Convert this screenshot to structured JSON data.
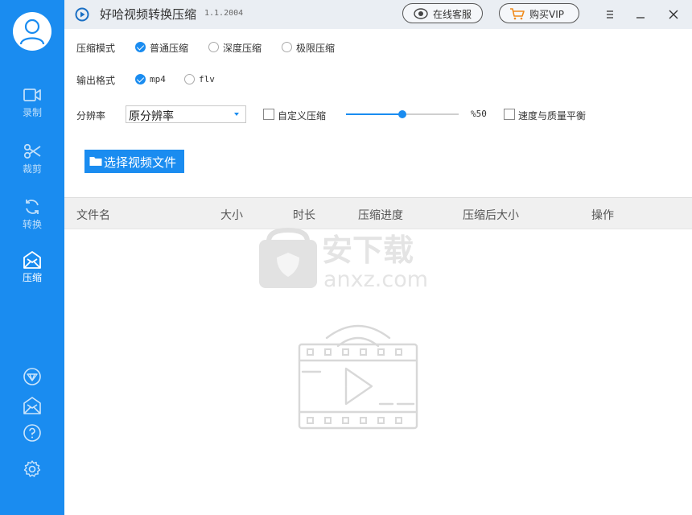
{
  "title_bar": {
    "app_title": "好哈视频转换压缩",
    "version": "1.1.2004",
    "support_button": "在线客服",
    "vip_button": "购买VIP"
  },
  "sidebar": {
    "items": [
      {
        "label": "录制",
        "icon": "video-camera-icon"
      },
      {
        "label": "裁剪",
        "icon": "scissors-icon"
      },
      {
        "label": "转换",
        "icon": "sync-icon"
      },
      {
        "label": "压缩",
        "icon": "envelope-compress-icon"
      }
    ],
    "bottom_icons": [
      "vip-diamond-icon",
      "mail-icon",
      "help-icon",
      "settings-icon"
    ]
  },
  "options": {
    "mode_label": "压缩模式",
    "modes": [
      {
        "label": "普通压缩",
        "checked": true
      },
      {
        "label": "深度压缩",
        "checked": false
      },
      {
        "label": "极限压缩",
        "checked": false
      }
    ],
    "format_label": "输出格式",
    "formats": [
      {
        "label": "mp4",
        "checked": true
      },
      {
        "label": "flv",
        "checked": false
      }
    ],
    "resolution_label": "分辨率",
    "resolution_value": "原分辨率",
    "custom_label": "自定义压缩",
    "custom_checked": false,
    "slider_percent": "%50",
    "slider_value": 0.5,
    "balance_label": "速度与质量平衡",
    "balance_checked": false
  },
  "select_file_button": "选择视频文件",
  "table": {
    "columns": [
      "文件名",
      "大小",
      "时长",
      "压缩进度",
      "压缩后大小",
      "操作"
    ]
  },
  "watermark": {
    "line1": "安下载",
    "line2": "anxz.com"
  },
  "colors": {
    "accent": "#1a8cf0",
    "titlebar": "#eaeef3",
    "table_header": "#f0f0f0"
  }
}
